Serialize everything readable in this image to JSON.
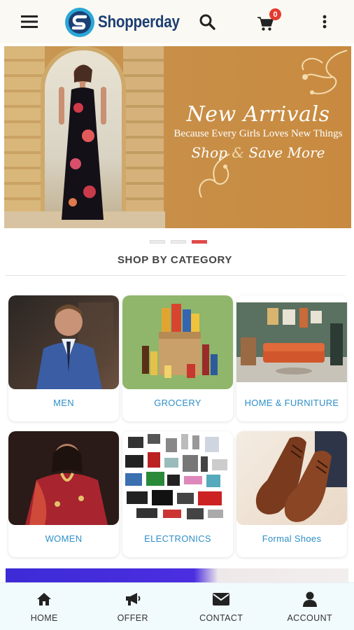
{
  "header": {
    "brand_name": "Shopperday",
    "cart_count": "0",
    "icons": [
      "menu-icon",
      "logo-icon",
      "search-icon",
      "cart-icon",
      "more-vertical-icon"
    ],
    "colors": {
      "background": "#fbf9f3",
      "brand": "#1c3f74",
      "logo_accent": "#2aa7d6",
      "badge": "#e53b2f"
    }
  },
  "banner": {
    "title": "New Arrivals",
    "subtitle": "Because Every Girls Loves New Things",
    "cta_shop": "Shop",
    "cta_amp": "&",
    "cta_save": "Save",
    "cta_more": "More",
    "slide_count": 3,
    "active_slide": 3,
    "colors": {
      "background": "#c88f47"
    }
  },
  "section": {
    "title": "SHOP BY CATEGORY"
  },
  "categories": [
    {
      "label": "MEN"
    },
    {
      "label": "GROCERY"
    },
    {
      "label": "HOME & FURNITURE"
    },
    {
      "label": "WOMEN"
    },
    {
      "label": "ELECTRONICS"
    },
    {
      "label": "Formal Shoes"
    }
  ],
  "bottom_nav": {
    "items": [
      {
        "label": "HOME",
        "icon": "home-icon"
      },
      {
        "label": "OFFER",
        "icon": "megaphone-icon"
      },
      {
        "label": "CONTACT",
        "icon": "envelope-icon"
      },
      {
        "label": "ACCOUNT",
        "icon": "user-icon"
      }
    ],
    "colors": {
      "background": "#f1fafd",
      "label": "#333333"
    }
  }
}
